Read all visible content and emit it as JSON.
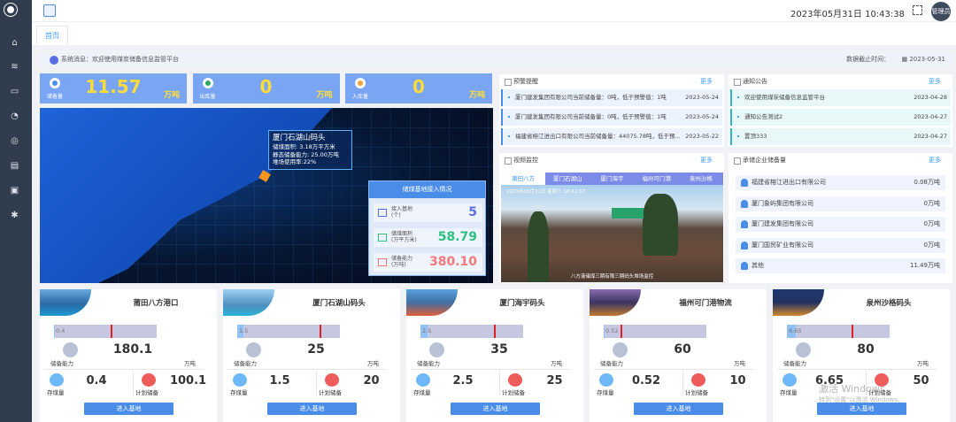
{
  "header": {
    "datetime": "2023年05月31日 10:43:38",
    "user": "管理员"
  },
  "tabs": [
    {
      "label": "首页"
    }
  ],
  "notice": {
    "message": "系统消息：欢迎使用煤炭储备信息监管平台",
    "cutoff_label": "数据截止时间：",
    "cutoff_date": "2023-05-31"
  },
  "stats": [
    {
      "label": "储备量",
      "value": "11.57",
      "unit": "万吨",
      "icon_color": "#4a8de8"
    },
    {
      "label": "出库量",
      "value": "0",
      "unit": "万吨",
      "icon_color": "#2aa866"
    },
    {
      "label": "入库量",
      "value": "0",
      "unit": "万吨",
      "icon_color": "#f3a33a"
    }
  ],
  "map": {
    "tooltip": {
      "title": "厦门石湖山码头",
      "lines": [
        "储煤面积: 3.18万平方米",
        "静态储备能力: 25.00万吨",
        "堆场使用率:22%"
      ]
    },
    "access": {
      "title": "储煤基地接入情况",
      "rows": [
        {
          "label": "接入基地",
          "unit": "(个)",
          "value": "5",
          "color": "#5b6ee1"
        },
        {
          "label": "储煤面积",
          "unit": "(万平方米)",
          "value": "58.79",
          "color": "#2fbf7f"
        },
        {
          "label": "储备能力",
          "unit": "(万吨)",
          "value": "380.10",
          "color": "#f07a7a"
        }
      ]
    }
  },
  "warnings": {
    "title": "预警提醒",
    "more": "更多",
    "items": [
      {
        "text": "厦门建发集团有限公司当前储备量：0吨，低于预警值：1吨",
        "date": "2023-05-24"
      },
      {
        "text": "厦门建发集团有限公司当前储备量：0吨，低于预警值：1吨",
        "date": "2023-05-24"
      },
      {
        "text": "福建省榕江进出口有限公司当前储备量：44075.78吨，低于预...",
        "date": "2023-05-22"
      }
    ]
  },
  "announcements": {
    "title": "通知公告",
    "more": "更多",
    "items": [
      {
        "text": "欢迎使用煤炭储备信息监管平台",
        "date": "2023-04-28"
      },
      {
        "text": "通知公告测试2",
        "date": "2023-04-27"
      },
      {
        "text": "置顶333",
        "date": "2023-04-27"
      }
    ]
  },
  "video": {
    "title": "视频监控",
    "more": "更多",
    "tabs": [
      "莆田八方",
      "厦门石湖山",
      "厦门海宇",
      "福州可门港",
      "泉州沙格"
    ],
    "active_tab": 0,
    "timestamp": "2023年05月31日 星期三 10:42:57",
    "caption": "八方港储煤三期有限三期码头堆场监控"
  },
  "enterprises": {
    "title": "承储企业储备量",
    "more": "更多",
    "items": [
      {
        "name": "福建省榕江进出口有限公司",
        "value": "0.08万吨"
      },
      {
        "name": "厦门象屿集团有限公司",
        "value": "0万吨"
      },
      {
        "name": "厦门建发集团有限公司",
        "value": "0万吨"
      },
      {
        "name": "厦门国贸矿业有限公司",
        "value": "0万吨"
      },
      {
        "name": "其他",
        "value": "11.49万吨"
      }
    ]
  },
  "bases": [
    {
      "name": "莆田八方港口",
      "storage": "0.4",
      "capacity": "180.1",
      "plan": "100.1"
    },
    {
      "name": "厦门石湖山码头",
      "storage": "1.5",
      "capacity": "25",
      "plan": "20"
    },
    {
      "name": "厦门海宇码头",
      "storage": "2.5",
      "capacity": "35",
      "plan": "25"
    },
    {
      "name": "福州可门港物流",
      "storage": "0.52",
      "capacity": "60",
      "plan": "10"
    },
    {
      "name": "泉州沙格码头",
      "storage": "6.65",
      "capacity": "80",
      "plan": "50"
    }
  ],
  "base_labels": {
    "capacity": "储备能力",
    "unit": "万吨",
    "storage": "存煤量",
    "plan": "计划储备",
    "enter": "进入基地"
  },
  "watermark": {
    "line1": "激活 Windows",
    "line2": "转到\"设置\"以激活 Windows。"
  }
}
